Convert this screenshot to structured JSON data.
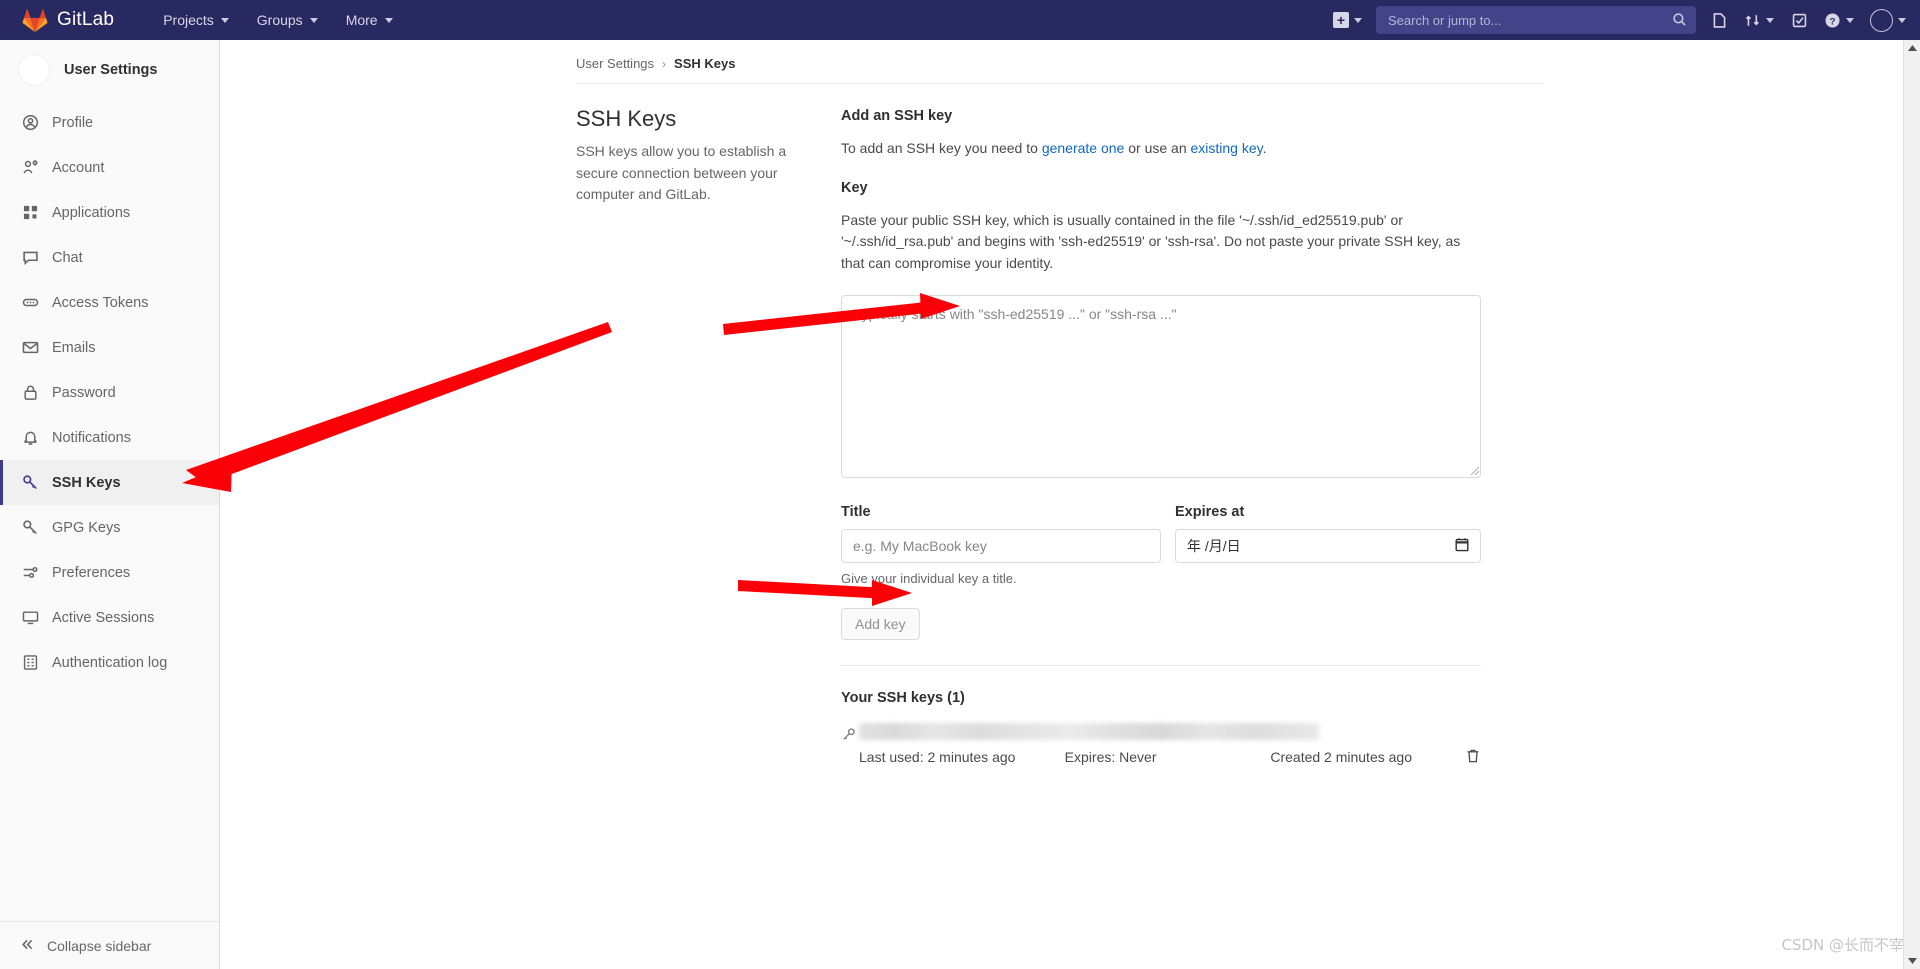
{
  "navbar": {
    "brand": "GitLab",
    "links": [
      {
        "label": "Projects",
        "name": "nav-projects"
      },
      {
        "label": "Groups",
        "name": "nav-groups"
      },
      {
        "label": "More",
        "name": "nav-more"
      }
    ],
    "search_placeholder": "Search or jump to...",
    "icons": {
      "create_new": "plus-icon",
      "issues": "issues-icon",
      "merge_requests": "merge-request-icon",
      "todos": "todo-done-icon",
      "help": "question-circle-icon",
      "avatar": "user-avatar"
    }
  },
  "sidebar": {
    "title": "User Settings",
    "items": [
      {
        "label": "Profile",
        "icon": "profile-icon",
        "active": false
      },
      {
        "label": "Account",
        "icon": "account-icon",
        "active": false
      },
      {
        "label": "Applications",
        "icon": "applications-icon",
        "active": false
      },
      {
        "label": "Chat",
        "icon": "chat-icon",
        "active": false
      },
      {
        "label": "Access Tokens",
        "icon": "token-icon",
        "active": false
      },
      {
        "label": "Emails",
        "icon": "email-icon",
        "active": false
      },
      {
        "label": "Password",
        "icon": "lock-icon",
        "active": false
      },
      {
        "label": "Notifications",
        "icon": "bell-icon",
        "active": false
      },
      {
        "label": "SSH Keys",
        "icon": "key-icon",
        "active": true
      },
      {
        "label": "GPG Keys",
        "icon": "key-icon",
        "active": false
      },
      {
        "label": "Preferences",
        "icon": "preferences-icon",
        "active": false
      },
      {
        "label": "Active Sessions",
        "icon": "monitor-icon",
        "active": false
      },
      {
        "label": "Authentication log",
        "icon": "log-icon",
        "active": false
      }
    ],
    "collapse_label": "Collapse sidebar"
  },
  "breadcrumb": {
    "parent": "User Settings",
    "separator": "›",
    "current": "SSH Keys"
  },
  "page": {
    "heading": "SSH Keys",
    "description": "SSH keys allow you to establish a secure connection between your computer and GitLab."
  },
  "add_key": {
    "section_title": "Add an SSH key",
    "intro_prefix": "To add an SSH key you need to ",
    "intro_link1": "generate one",
    "intro_middle": " or use an ",
    "intro_link2": "existing key",
    "intro_suffix": ".",
    "key_label": "Key",
    "key_help": "Paste your public SSH key, which is usually contained in the file '~/.ssh/id_ed25519.pub' or '~/.ssh/id_rsa.pub' and begins with 'ssh-ed25519' or 'ssh-rsa'. Do not paste your private SSH key, as that can compromise your identity.",
    "key_placeholder": "Typically starts with \"ssh-ed25519 ...\" or \"ssh-rsa ...\"",
    "key_value": "",
    "title_label": "Title",
    "title_placeholder": "e.g. My MacBook key",
    "title_value": "",
    "title_help": "Give your individual key a title.",
    "expires_label": "Expires at",
    "expires_placeholder": "年 /月/日",
    "expires_value": "",
    "submit_label": "Add key"
  },
  "keys_list": {
    "heading": "Your SSH keys (1)",
    "rows": [
      {
        "name": "",
        "last_used": "Last used: 2 minutes ago",
        "expires": "Expires: Never",
        "created": "Created 2 minutes ago",
        "delete_icon": "trash-icon"
      }
    ]
  },
  "watermark": "CSDN @长而不宰",
  "colors": {
    "navbar_bg": "#292961",
    "accent_link": "#1068bf",
    "active_border": "#3c3c8c",
    "annotation_arrow": "#fb0007"
  }
}
